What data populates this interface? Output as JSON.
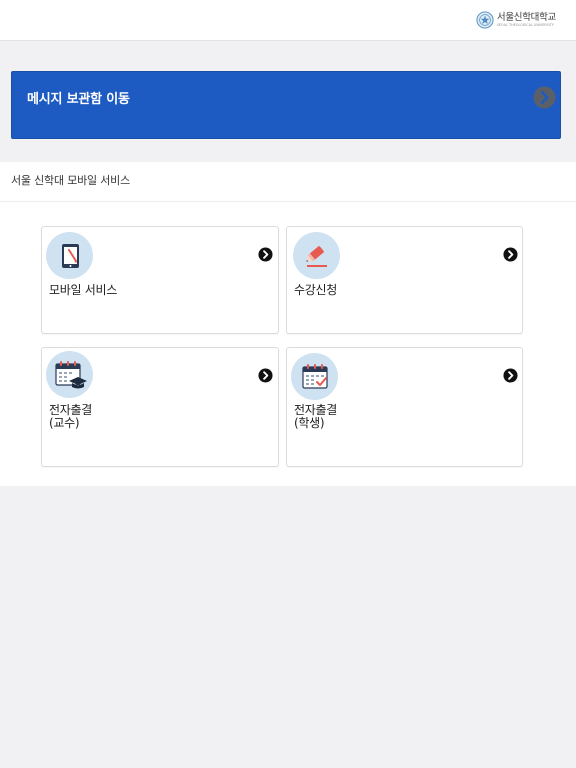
{
  "header": {
    "logo_ko": "서울신학대학교",
    "logo_en": "SEOUL THEOLOGICAL UNIVERSITY"
  },
  "banner": {
    "label": "메시지 보관함 이동",
    "color": "#1d5bc2",
    "arrow_icon": "chevron-right-circle-icon"
  },
  "section": {
    "title": "서울 신학대 모바일 서비스"
  },
  "cards": [
    {
      "label": "모바일 서비스",
      "icon": "tablet-icon"
    },
    {
      "label": "수강신청",
      "icon": "pencil-icon"
    },
    {
      "label_line1": "전자출결",
      "label_line2": "(교수)",
      "icon": "calendar-graduation-cap-icon"
    },
    {
      "label_line1": "전자출결",
      "label_line2": "(학생)",
      "icon": "calendar-check-icon"
    }
  ],
  "colors": {
    "icon_circle": "#cfe2f1",
    "page_background": "#f1f1f3",
    "accent_red": "#e85a4f",
    "icon_navy": "#2b3a55"
  }
}
